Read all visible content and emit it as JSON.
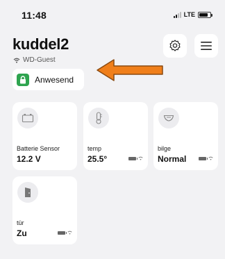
{
  "status_bar": {
    "time": "11:48",
    "network": "LTE"
  },
  "header": {
    "title": "kuddel2",
    "wifi_name": "WD-Guest",
    "settings_icon": "gear-icon",
    "menu_icon": "hamburger-icon"
  },
  "presence": {
    "label": "Anwesend",
    "icon": "lock-icon",
    "color": "#2ea44f"
  },
  "annotation": {
    "arrow_color": "#f07f1a"
  },
  "devices": [
    {
      "name": "Batterie Sensor",
      "value": "12.2 V",
      "icon": "battery-icon"
    },
    {
      "name": "temp",
      "value": "25.5°",
      "icon": "thermometer-icon"
    },
    {
      "name": "bilge",
      "value": "Normal",
      "icon": "leak-sensor-icon"
    },
    {
      "name": "tür",
      "value": "Zu",
      "icon": "door-icon"
    }
  ]
}
